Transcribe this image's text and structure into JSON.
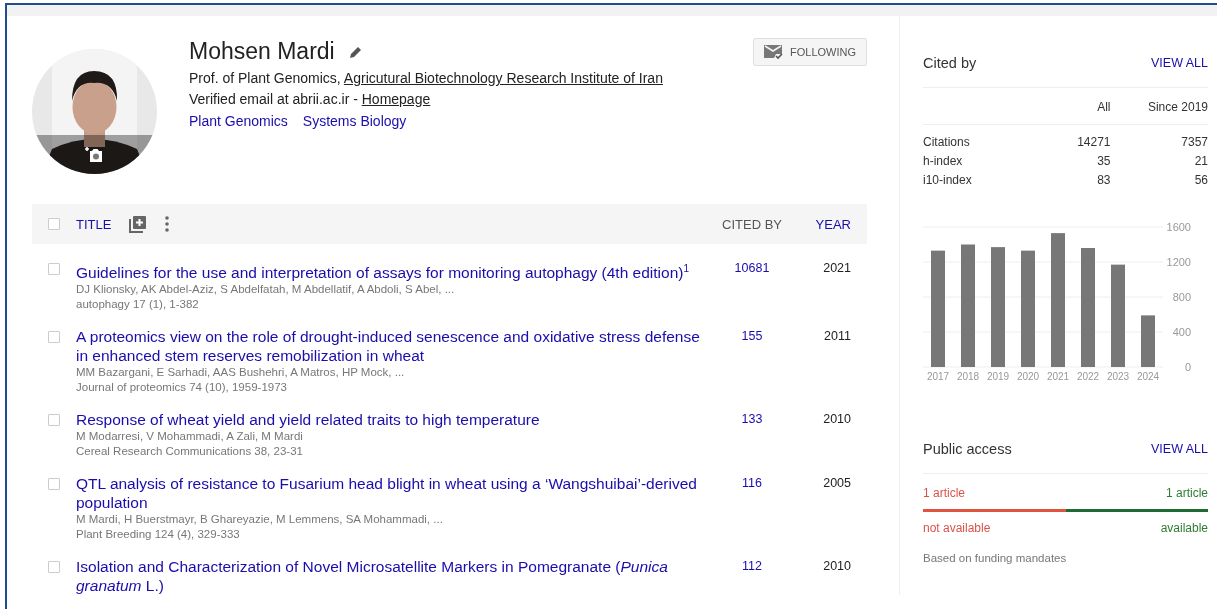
{
  "profile": {
    "name": "Mohsen Mardi",
    "affiliation_prefix": "Prof. of Plant Genomics, ",
    "affiliation_link": "Agricutural Biotechnology Research Institute of Iran",
    "email": "Verified email at abrii.ac.ir - ",
    "homepage": "Homepage",
    "interests": [
      "Plant Genomics",
      "Systems Biology"
    ],
    "follow_button": "FOLLOWING"
  },
  "table": {
    "header": {
      "checked": false,
      "title": "TITLE",
      "cited_by": "CITED BY",
      "year": "YEAR"
    },
    "rows": [
      {
        "checked": false,
        "title": "Guidelines for the use and interpretation of assays for monitoring autophagy (4th edition)$^{1}$",
        "authors": "DJ Klionsky, AK Abdel-Aziz, S Abdelfatah, M Abdellatif, A Abdoli, S Abel, ...",
        "venue": "autophagy 17 (1), 1-382",
        "cited_by": "10681",
        "year": "2021"
      },
      {
        "checked": false,
        "title": "A proteomics view on the role of drought-induced senescence and oxidative stress defense in enhanced stem reserves remobilization in wheat",
        "authors": "MM Bazargani, E Sarhadi, AAS Bushehri, A Matros, HP Mock, ...",
        "venue": "Journal of proteomics 74 (10), 1959-1973",
        "cited_by": "155",
        "year": "2011"
      },
      {
        "checked": false,
        "title": "Response of wheat yield and yield related traits to high temperature",
        "authors": "M Modarresi, V Mohammadi, A Zali, M Mardi",
        "venue": "Cereal Research Communications 38, 23-31",
        "cited_by": "133",
        "year": "2010"
      },
      {
        "checked": false,
        "title": "QTL analysis of resistance to Fusarium head blight in wheat using a ‘Wangshuibai’-derived population",
        "authors": "M Mardi, H Buerstmayr, B Ghareyazie, M Lemmens, SA Mohammadi, ...",
        "venue": "Plant Breeding 124 (4), 329-333",
        "cited_by": "116",
        "year": "2005"
      },
      {
        "checked": false,
        "title": "Isolation and Characterization of Novel Microsatellite Markers in Pomegranate (*Punica granatum* L.)",
        "cited_by": "112",
        "year": "2010"
      }
    ]
  },
  "cited_by": {
    "title": "Cited by",
    "view_all": "VIEW ALL",
    "columns": [
      "All",
      "Since 2019"
    ],
    "rows": [
      {
        "label": "Citations",
        "all": "14271",
        "since": "7357"
      },
      {
        "label": "h-index",
        "all": "35",
        "since": "21"
      },
      {
        "label": "i10-index",
        "all": "83",
        "since": "56"
      }
    ],
    "chart_data": {
      "type": "bar",
      "categories": [
        "2017",
        "2018",
        "2019",
        "2020",
        "2021",
        "2022",
        "2023",
        "2024"
      ],
      "series": [
        {
          "color": "#777777",
          "values": [
            1330,
            1400,
            1370,
            1330,
            1530,
            1360,
            1170,
            590
          ]
        }
      ],
      "grid": true,
      "ylim": [
        0,
        1600
      ],
      "yticks": [
        0,
        400,
        800,
        1200,
        1600
      ]
    }
  },
  "public_access": {
    "title": "Public access",
    "view_all": "VIEW ALL",
    "not_available_count": "1 article",
    "available_count": "1 article",
    "level": 0.5,
    "not_available": "not available",
    "available": "available",
    "note": "Based on funding mandates"
  }
}
